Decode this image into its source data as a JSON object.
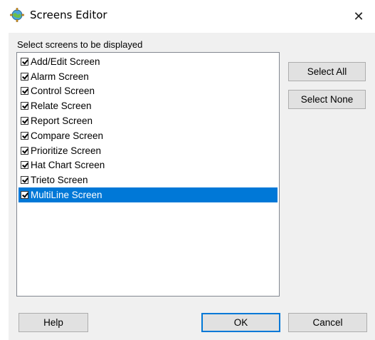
{
  "window": {
    "title": "Screens Editor",
    "close_glyph": "✕",
    "icon": "gear-globe-icon"
  },
  "dialog": {
    "prompt": "Select screens to be displayed",
    "items": [
      {
        "label": "Add/Edit Screen",
        "checked": true,
        "selected": false
      },
      {
        "label": "Alarm Screen",
        "checked": true,
        "selected": false
      },
      {
        "label": "Control Screen",
        "checked": true,
        "selected": false
      },
      {
        "label": "Relate Screen",
        "checked": true,
        "selected": false
      },
      {
        "label": "Report Screen",
        "checked": true,
        "selected": false
      },
      {
        "label": "Compare Screen",
        "checked": true,
        "selected": false
      },
      {
        "label": "Prioritize Screen",
        "checked": true,
        "selected": false
      },
      {
        "label": "Hat Chart Screen",
        "checked": true,
        "selected": false
      },
      {
        "label": "Trieto Screen",
        "checked": true,
        "selected": false
      },
      {
        "label": "MultiLine Screen",
        "checked": true,
        "selected": true
      }
    ],
    "buttons": {
      "select_all": "Select All",
      "select_none": "Select None",
      "help": "Help",
      "ok": "OK",
      "cancel": "Cancel"
    }
  },
  "colors": {
    "selection": "#0078d7",
    "dialog_bg": "#f0f0f0",
    "button_bg": "#e1e1e1"
  }
}
